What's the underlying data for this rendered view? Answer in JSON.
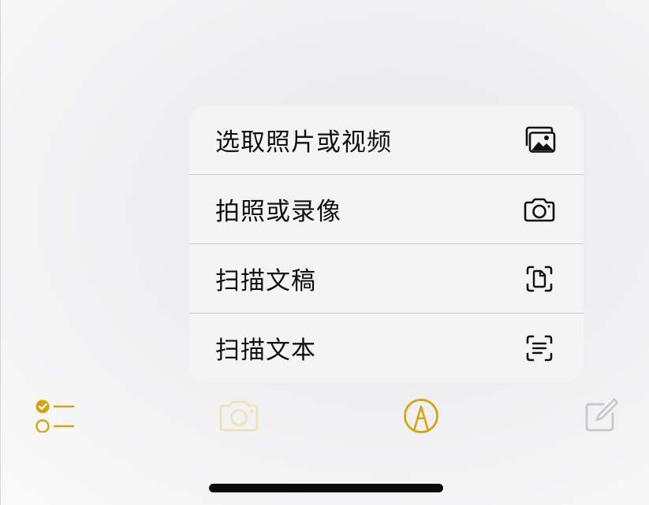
{
  "menu": {
    "items": [
      {
        "label": "选取照片或视频",
        "icon": "photo-library-icon"
      },
      {
        "label": "拍照或录像",
        "icon": "camera-icon"
      },
      {
        "label": "扫描文稿",
        "icon": "doc-scan-icon"
      },
      {
        "label": "扫描文本",
        "icon": "text-scan-icon"
      }
    ]
  },
  "toolbar": {
    "items": [
      {
        "icon": "checklist-icon",
        "state": "enabled"
      },
      {
        "icon": "camera-icon",
        "state": "dimmed"
      },
      {
        "icon": "markup-pen-icon",
        "state": "enabled"
      },
      {
        "icon": "compose-icon",
        "state": "disabled"
      }
    ]
  },
  "colors": {
    "accent": "#d4a411",
    "accent_dim": "#efe2b9",
    "disabled": "#c9c9cc",
    "menu_bg": "#f4f4f5",
    "separator": "#c9c9cc",
    "text": "#111111"
  }
}
